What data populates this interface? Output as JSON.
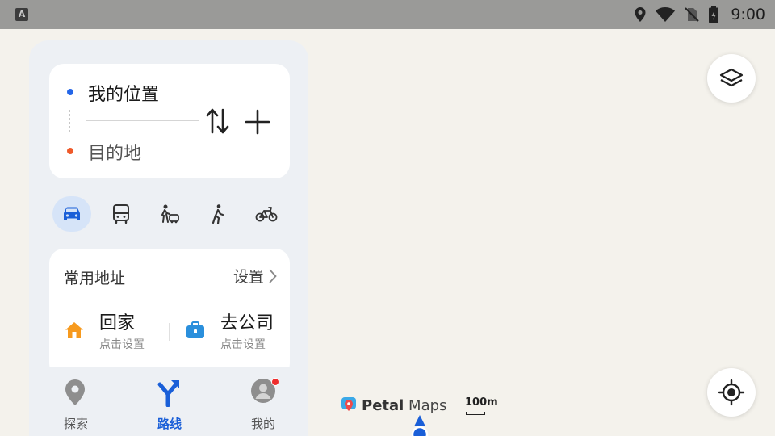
{
  "status_bar": {
    "app_icon_letter": "A",
    "time": "9:00",
    "icons": [
      "location-icon",
      "wifi-icon",
      "no-sim-icon",
      "battery-icon"
    ]
  },
  "route": {
    "start_label": "我的位置",
    "end_label": "目的地"
  },
  "travel_modes": [
    {
      "name": "drive",
      "icon": "car-icon",
      "selected": true
    },
    {
      "name": "transit",
      "icon": "bus-icon",
      "selected": false
    },
    {
      "name": "taxi",
      "icon": "taxi-icon",
      "selected": false
    },
    {
      "name": "walk",
      "icon": "walk-icon",
      "selected": false
    },
    {
      "name": "bike",
      "icon": "bike-icon",
      "selected": false
    }
  ],
  "favorites": {
    "title": "常用地址",
    "settings_label": "设置",
    "home": {
      "name": "回家",
      "sub": "点击设置"
    },
    "work": {
      "name": "去公司",
      "sub": "点击设置"
    }
  },
  "bottom_nav": {
    "explore": "探索",
    "route": "路线",
    "mine": "我的"
  },
  "map": {
    "brand_bold": "Petal",
    "brand_rest": " Maps",
    "scale_label": "100m"
  },
  "colors": {
    "accent": "#1a5fd8",
    "start_dot": "#2466e8",
    "end_dot": "#ef5a2a",
    "badge": "#ef2d2d",
    "status_bar": "#9a9a98",
    "map_bg": "#f4f2ec"
  }
}
